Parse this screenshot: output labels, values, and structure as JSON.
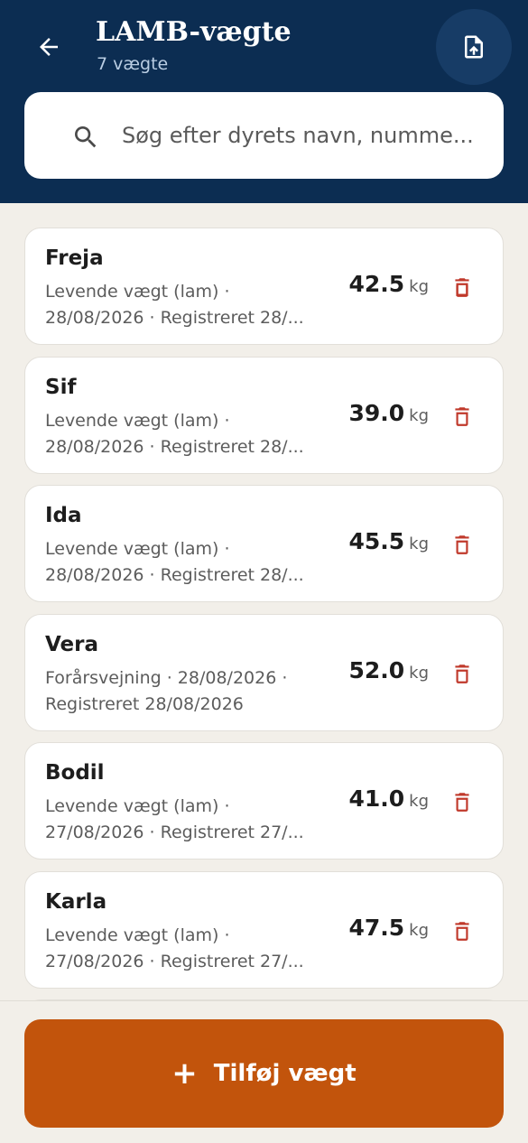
{
  "header": {
    "title": "LAMB-vægte",
    "subtitle": "7 vægte",
    "back_icon": "arrow-left-icon",
    "export_icon": "file-upload-icon"
  },
  "search": {
    "placeholder": "Søg efter dyrets navn, numme..."
  },
  "weights": [
    {
      "name": "Freja",
      "meta1": "Levende vægt (lam) ·",
      "meta2": "28/08/2026 · Registreret 28/...",
      "value": "42.5",
      "unit": "kg"
    },
    {
      "name": "Sif",
      "meta1": "Levende vægt (lam) ·",
      "meta2": "28/08/2026 · Registreret 28/...",
      "value": "39.0",
      "unit": "kg"
    },
    {
      "name": "Ida",
      "meta1": "Levende vægt (lam) ·",
      "meta2": "28/08/2026 · Registreret 28/...",
      "value": "45.5",
      "unit": "kg"
    },
    {
      "name": "Vera",
      "meta1": "Forårsvejning · 28/08/2026 ·",
      "meta2": "Registreret 28/08/2026",
      "value": "52.0",
      "unit": "kg"
    },
    {
      "name": "Bodil",
      "meta1": "Levende vægt (lam) ·",
      "meta2": "27/08/2026 · Registreret 27/...",
      "value": "41.0",
      "unit": "kg"
    },
    {
      "name": "Karla",
      "meta1": "Levende vægt (lam) ·",
      "meta2": "27/08/2026 · Registreret 27/...",
      "value": "47.5",
      "unit": "kg"
    }
  ],
  "footer": {
    "add_label": "Tilføj vægt",
    "add_symbol": "+"
  },
  "colors": {
    "header_bg": "#0c2d52",
    "accent": "#c2540c",
    "delete": "#c0392b",
    "background": "#f2efe9"
  }
}
